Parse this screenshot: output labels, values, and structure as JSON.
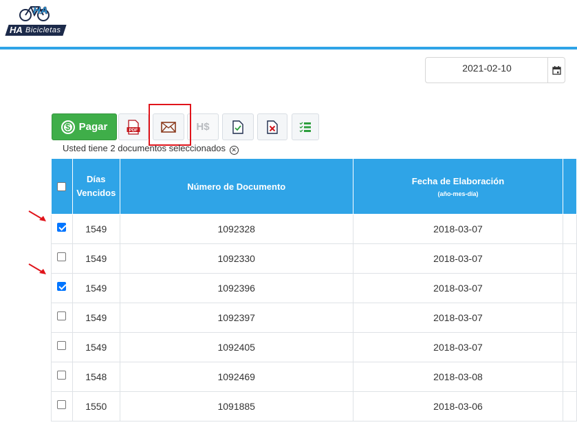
{
  "brand": {
    "mark": "HA",
    "name": "Bicicletas"
  },
  "date_picker": {
    "value": "2021-02-10",
    "icon": "calendar-icon"
  },
  "toolbar": {
    "pay_label": "Pagar",
    "pay_icon": "dollar-coin-icon",
    "pdf_icon": "pdf-icon",
    "mail_icon": "envelope-icon",
    "hs_label": "H$",
    "doc_check_icon": "document-check-icon",
    "doc_x_icon": "document-x-icon",
    "list_icon": "checklist-icon"
  },
  "selection": {
    "message": "Usted tiene 2 documentos seleccionados",
    "clear_icon": "close-circle-icon"
  },
  "table": {
    "headers": {
      "dias": "Días Vencidos",
      "numero": "Número de Documento",
      "fecha": "Fecha de Elaboración",
      "fecha_sub": "(año-mes-día)"
    },
    "rows": [
      {
        "checked": true,
        "dias": "1549",
        "numero": "1092328",
        "fecha": "2018-03-07"
      },
      {
        "checked": false,
        "dias": "1549",
        "numero": "1092330",
        "fecha": "2018-03-07"
      },
      {
        "checked": true,
        "dias": "1549",
        "numero": "1092396",
        "fecha": "2018-03-07"
      },
      {
        "checked": false,
        "dias": "1549",
        "numero": "1092397",
        "fecha": "2018-03-07"
      },
      {
        "checked": false,
        "dias": "1549",
        "numero": "1092405",
        "fecha": "2018-03-07"
      },
      {
        "checked": false,
        "dias": "1548",
        "numero": "1092469",
        "fecha": "2018-03-08"
      },
      {
        "checked": false,
        "dias": "1550",
        "numero": "1091885",
        "fecha": "2018-03-06"
      }
    ]
  },
  "colors": {
    "accent": "#2fa4e7",
    "pay": "#3fae49",
    "highlight": "#e0141b",
    "checkbox": "#0075ff"
  }
}
